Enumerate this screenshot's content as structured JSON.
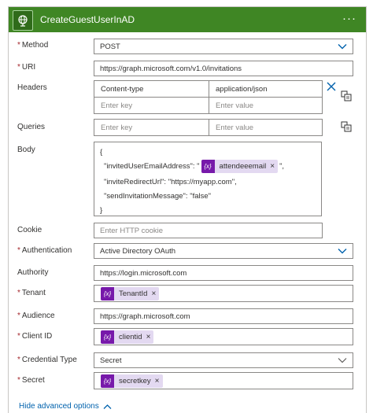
{
  "header": {
    "title": "CreateGuestUserInAD",
    "more": "···"
  },
  "method": {
    "label": "Method",
    "value": "POST"
  },
  "uri": {
    "label": "URI",
    "value": "https://graph.microsoft.com/v1.0/invitations"
  },
  "headers": {
    "label": "Headers",
    "row1": {
      "key": "Content-type",
      "value": "application/json"
    },
    "row2": {
      "key_placeholder": "Enter key",
      "value_placeholder": "Enter value"
    }
  },
  "queries": {
    "label": "Queries",
    "key_placeholder": "Enter key",
    "value_placeholder": "Enter value"
  },
  "body": {
    "label": "Body",
    "open_brace": "{",
    "line1_prefix": "\"invitedUserEmailAddress\": \"",
    "line1_token": "attendeeemail",
    "line1_suffix": "\",",
    "line2": "\"inviteRedirectUrl\": \"https://myapp.com\",",
    "line3": "\"sendInvitationMessage\": \"false\"",
    "close_brace": "}"
  },
  "cookie": {
    "label": "Cookie",
    "placeholder": "Enter HTTP cookie"
  },
  "authentication": {
    "label": "Authentication",
    "value": "Active Directory OAuth"
  },
  "authority": {
    "label": "Authority",
    "value": "https://login.microsoft.com"
  },
  "tenant": {
    "label": "Tenant",
    "token": "TenantId"
  },
  "audience": {
    "label": "Audience",
    "value": "https://graph.microsoft.com"
  },
  "client_id": {
    "label": "Client ID",
    "token": "clientid"
  },
  "credential_type": {
    "label": "Credential Type",
    "value": "Secret"
  },
  "secret": {
    "label": "Secret",
    "token": "secretkey"
  },
  "footer": {
    "hide_advanced": "Hide advanced options"
  },
  "token_fx": "{x}",
  "colors": {
    "header_bg": "#3f8624",
    "token_fx_bg": "#7719aa",
    "token_bg": "#e3d9f1",
    "link": "#0062ad",
    "dropdown_chevron": "#0062ad"
  }
}
